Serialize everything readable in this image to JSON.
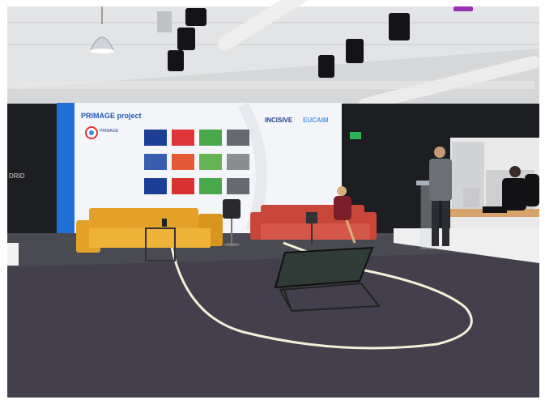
{
  "screen": {
    "title": "PRIMAGE project",
    "logo_text": "PRIMAGE",
    "partner_logos": [
      "INCISIVE",
      "EUCAIM"
    ]
  },
  "wall_sign": "DRID",
  "colors": {
    "ceiling": "#d7d8d9",
    "wall": "#1b1c1f",
    "floor": "#4a4a52",
    "sofa": "#e3a12a",
    "sofa_red": "#c9473a",
    "screen_bg": "#f4f5f9",
    "screen_accent": "#1f6fd6",
    "light_strip": "#f3f1d8"
  },
  "grid_colors": [
    [
      "#1c3f95",
      "#e0363a",
      "#4aa84c",
      "#666a70"
    ],
    [
      "#3b5db0",
      "#e35b34",
      "#68b256",
      "#8a8d92"
    ],
    [
      "#1c3f95",
      "#d8312f",
      "#4aa84c",
      "#666a70"
    ]
  ]
}
